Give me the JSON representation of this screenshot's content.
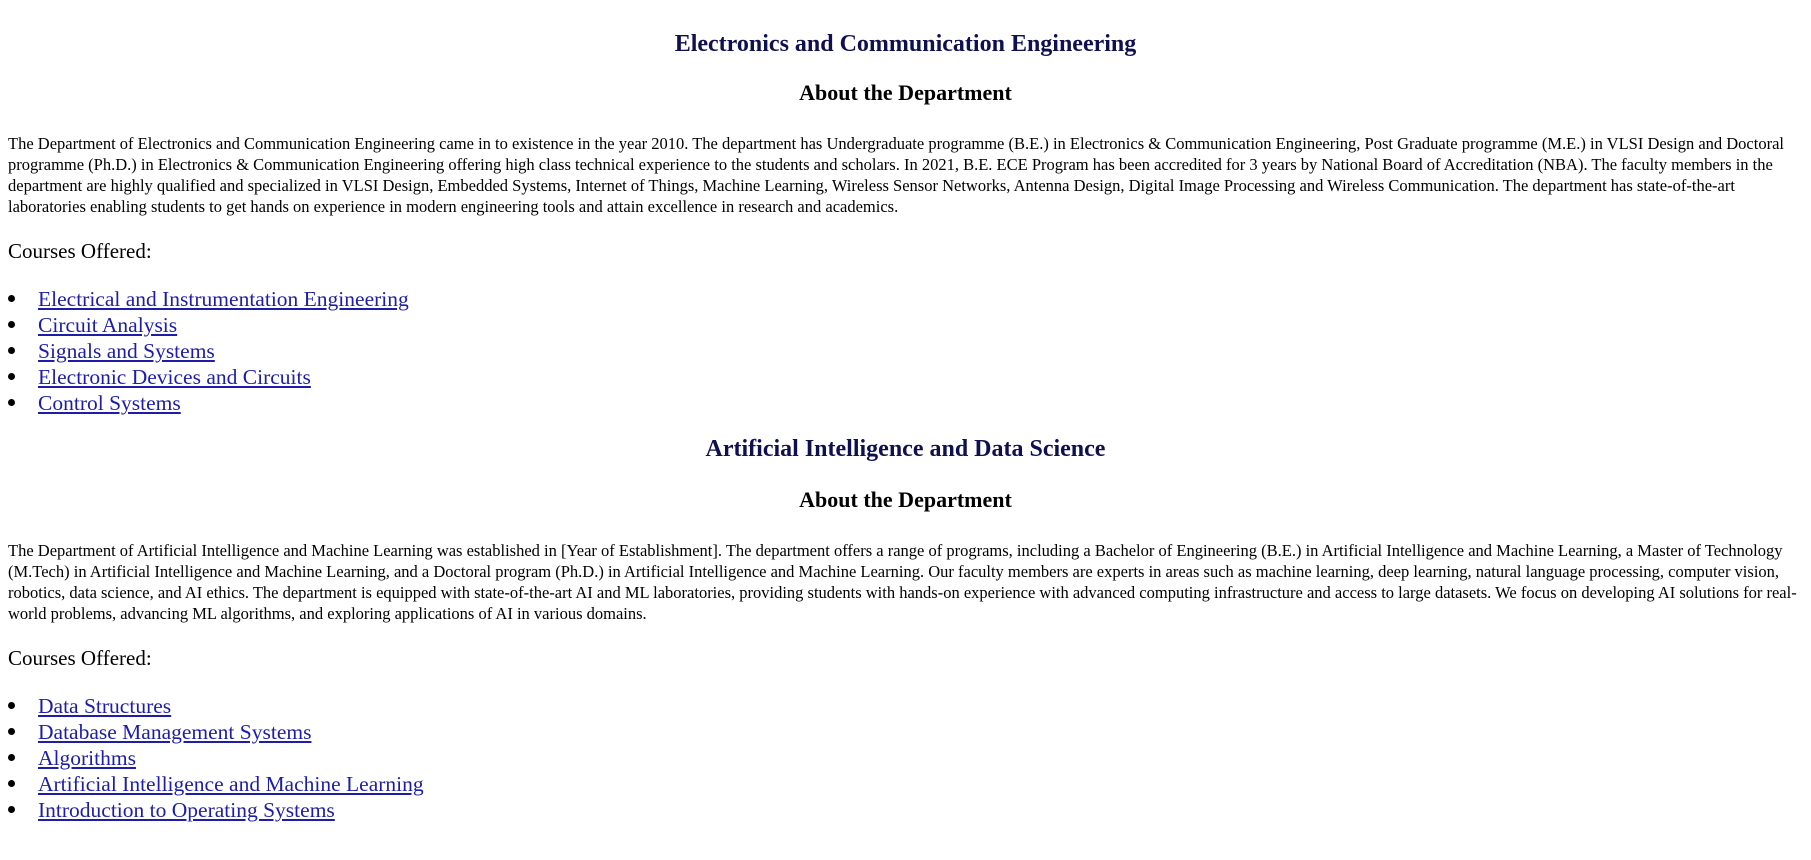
{
  "departments": [
    {
      "title": "Electronics and Communication Engineering",
      "about_heading": "About the Department",
      "about_text": "The Department of Electronics and Communication Engineering came in to existence in the year 2010. The department has Undergraduate programme (B.E.) in Electronics & Communication Engineering, Post Graduate programme (M.E.) in VLSI Design and Doctoral programme (Ph.D.) in Electronics & Communication Engineering offering high class technical experience to the students and scholars. In 2021, B.E. ECE Program has been accredited for 3 years by National Board of Accreditation (NBA). The faculty members in the department are highly qualified and specialized in VLSI Design, Embedded Systems, Internet of Things, Machine Learning, Wireless Sensor Networks, Antenna Design, Digital Image Processing and Wireless Communication. The department has state-of-the-art laboratories enabling students to get hands on experience in modern engineering tools and attain excellence in research and academics.",
      "courses_label": "Courses Offered:",
      "courses": [
        "Electrical and Instrumentation Engineering",
        "Circuit Analysis",
        "Signals and Systems",
        "Electronic Devices and Circuits",
        "Control Systems"
      ]
    },
    {
      "title": "Artificial Intelligence and Data Science",
      "about_heading": "About the Department",
      "about_text": "The Department of Artificial Intelligence and Machine Learning was established in [Year of Establishment]. The department offers a range of programs, including a Bachelor of Engineering (B.E.) in Artificial Intelligence and Machine Learning, a Master of Technology (M.Tech) in Artificial Intelligence and Machine Learning, and a Doctoral program (Ph.D.) in Artificial Intelligence and Machine Learning. Our faculty members are experts in areas such as machine learning, deep learning, natural language processing, computer vision, robotics, data science, and AI ethics. The department is equipped with state-of-the-art AI and ML laboratories, providing students with hands-on experience with advanced computing infrastructure and access to large datasets. We focus on developing AI solutions for real-world problems, advancing ML algorithms, and exploring applications of AI in various domains.",
      "courses_label": "Courses Offered:",
      "courses": [
        "Data Structures",
        "Database Management Systems",
        "Algorithms",
        "Artificial Intelligence and Machine Learning",
        "Introduction to Operating Systems"
      ]
    }
  ],
  "colors": {
    "heading": "#0e1050",
    "link": "#1d1da8",
    "text": "#000000",
    "background": "#ffffff"
  }
}
